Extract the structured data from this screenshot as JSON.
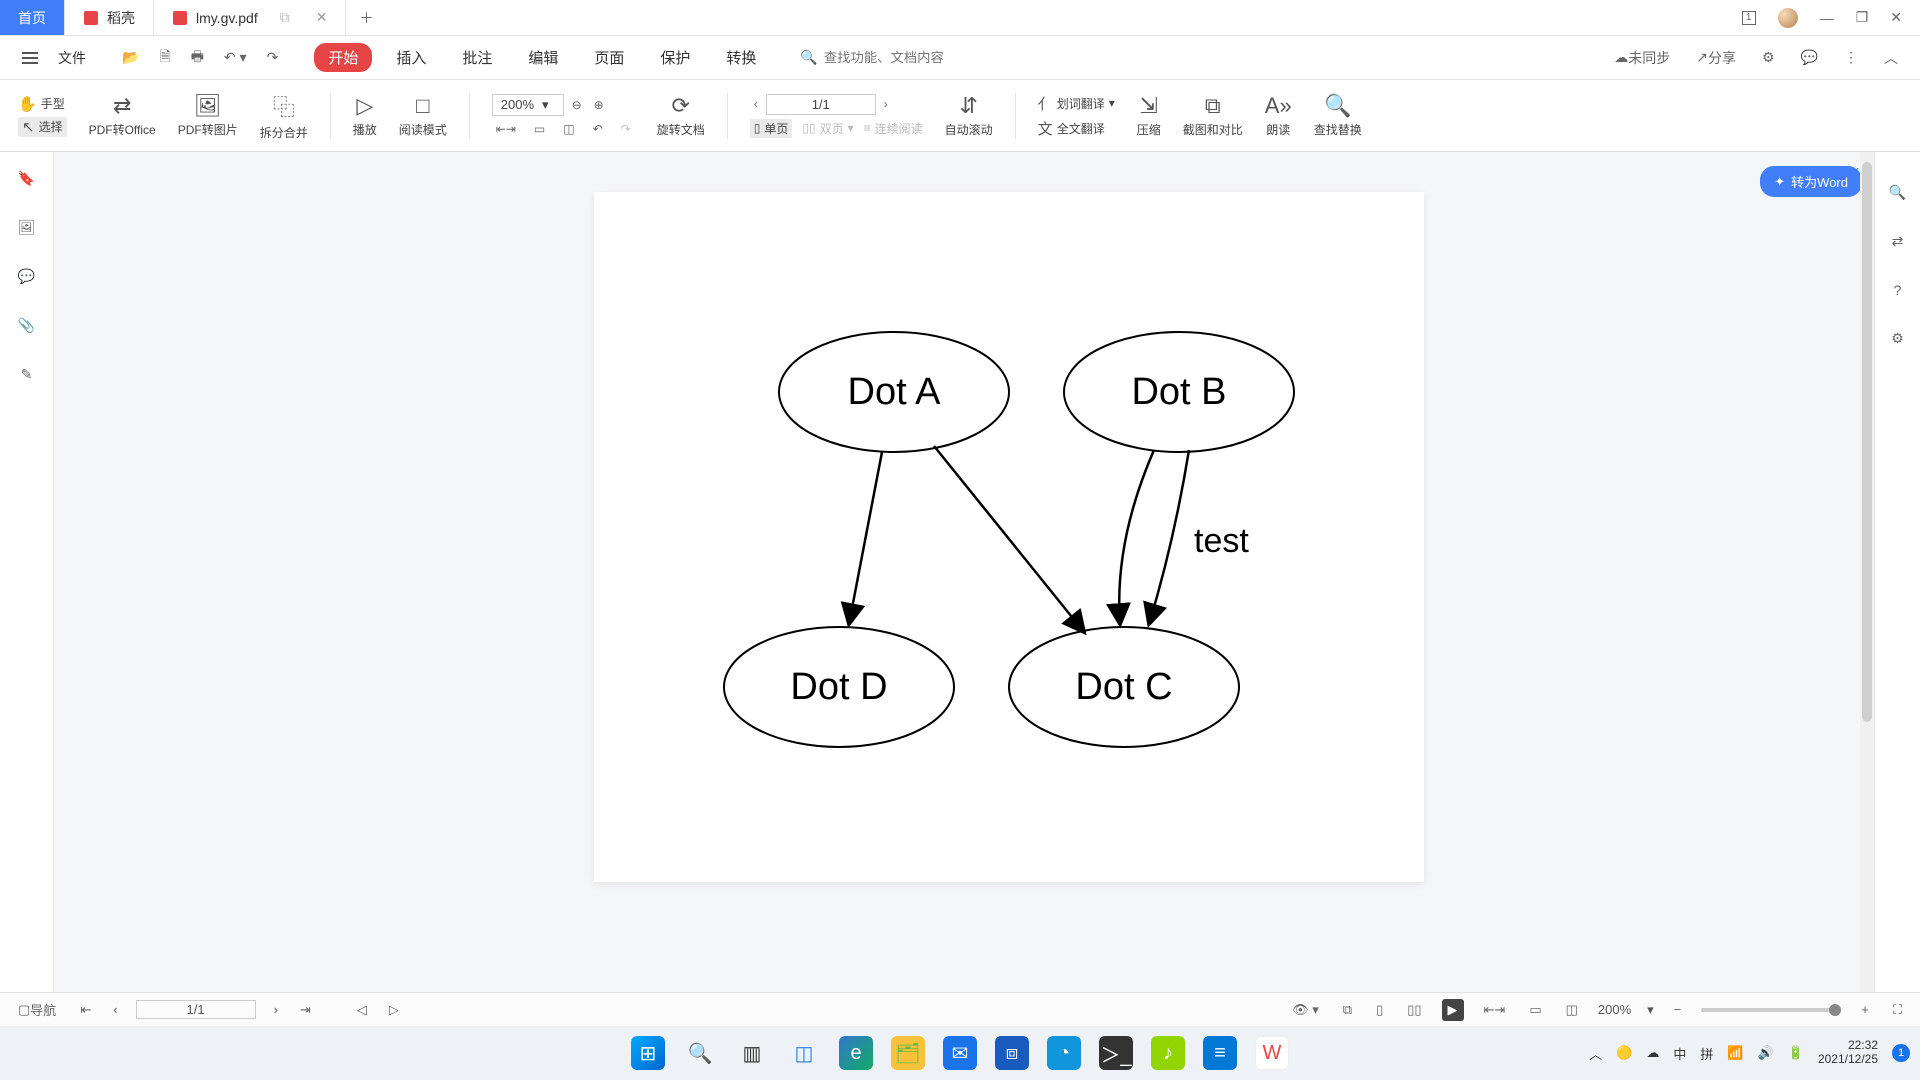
{
  "titlebar": {
    "home": "首页",
    "tab1": "稻壳",
    "tab2": "lmy.gv.pdf",
    "badge": "1"
  },
  "menubar": {
    "file": "文件",
    "items": [
      "开始",
      "插入",
      "批注",
      "编辑",
      "页面",
      "保护",
      "转换"
    ],
    "search_placeholder": "查找功能、文档内容",
    "unsynced": "未同步",
    "share": "分享"
  },
  "ribbon": {
    "hand": "手型",
    "select": "选择",
    "pdf2office": "PDF转Office",
    "pdf2img": "PDF转图片",
    "splitmerge": "拆分合并",
    "play": "播放",
    "readmode": "阅读模式",
    "zoom_value": "200%",
    "rotate": "旋转文档",
    "single": "单页",
    "double": "双页",
    "continuous": "连续阅读",
    "page_value": "1/1",
    "autoscroll": "自动滚动",
    "sel_translate": "划词翻译",
    "full_translate": "全文翻译",
    "compress": "压缩",
    "screenshot": "截图和对比",
    "tts": "朗读",
    "findreplace": "查找替换"
  },
  "viewport": {
    "convert": "转为Word"
  },
  "graph": {
    "nodes": {
      "a": "Dot A",
      "b": "Dot B",
      "c": "Dot C",
      "d": "Dot D"
    },
    "edge_label": "test"
  },
  "bottombar": {
    "nav": "导航",
    "page": "1/1",
    "zoom": "200%"
  },
  "tray": {
    "ime1": "中",
    "ime2": "拼",
    "time": "22:32",
    "date": "2021/12/25",
    "notify": "1"
  }
}
